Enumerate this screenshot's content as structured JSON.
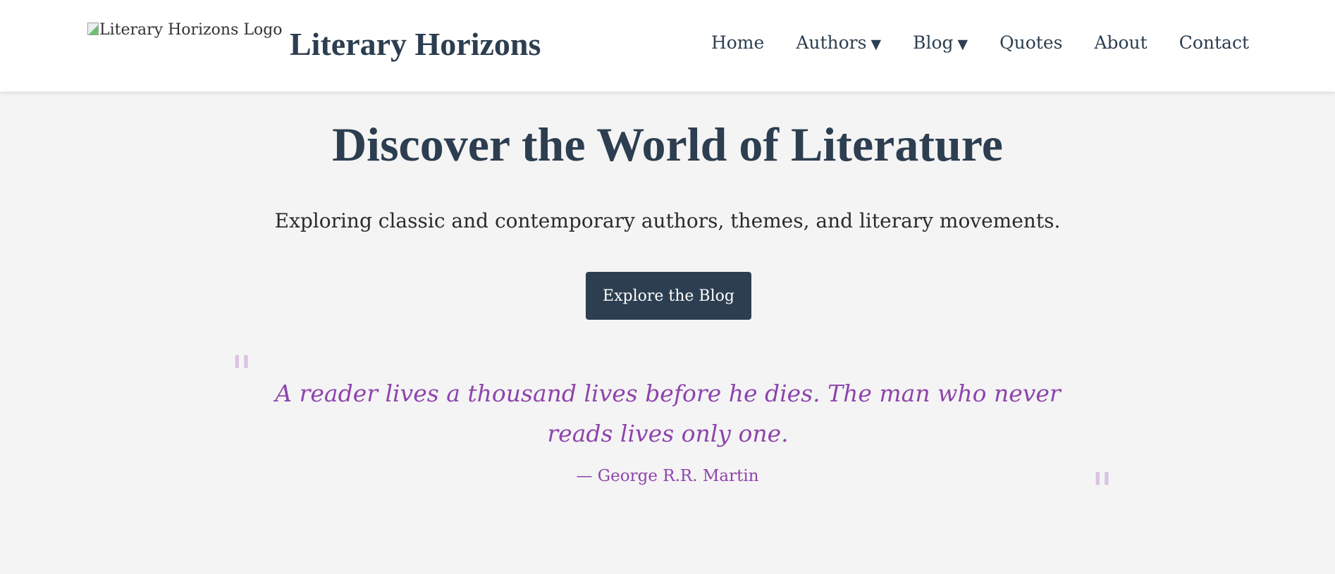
{
  "header": {
    "logo_alt": "Literary Horizons Logo",
    "site_title": "Literary Horizons",
    "nav": [
      {
        "label": "Home"
      },
      {
        "label": "Authors",
        "caret": "▼"
      },
      {
        "label": "Blog",
        "caret": "▼"
      },
      {
        "label": "Quotes"
      },
      {
        "label": "About"
      },
      {
        "label": "Contact"
      }
    ]
  },
  "hero": {
    "title": "Discover the World of Literature",
    "subtitle": "Exploring classic and contemporary authors, themes, and literary movements.",
    "cta_label": "Explore the Blog"
  },
  "quote": {
    "open_mark": "\"",
    "close_mark": "\"",
    "text": "A reader lives a thousand lives before he dies. The man who never reads lives only one.",
    "author": "— George R.R. Martin"
  },
  "colors": {
    "primary": "#2c3e50",
    "accent": "#8e44ad",
    "quote_mark": "#d9c4e0",
    "background": "#f4f4f4",
    "header_bg": "#ffffff"
  }
}
